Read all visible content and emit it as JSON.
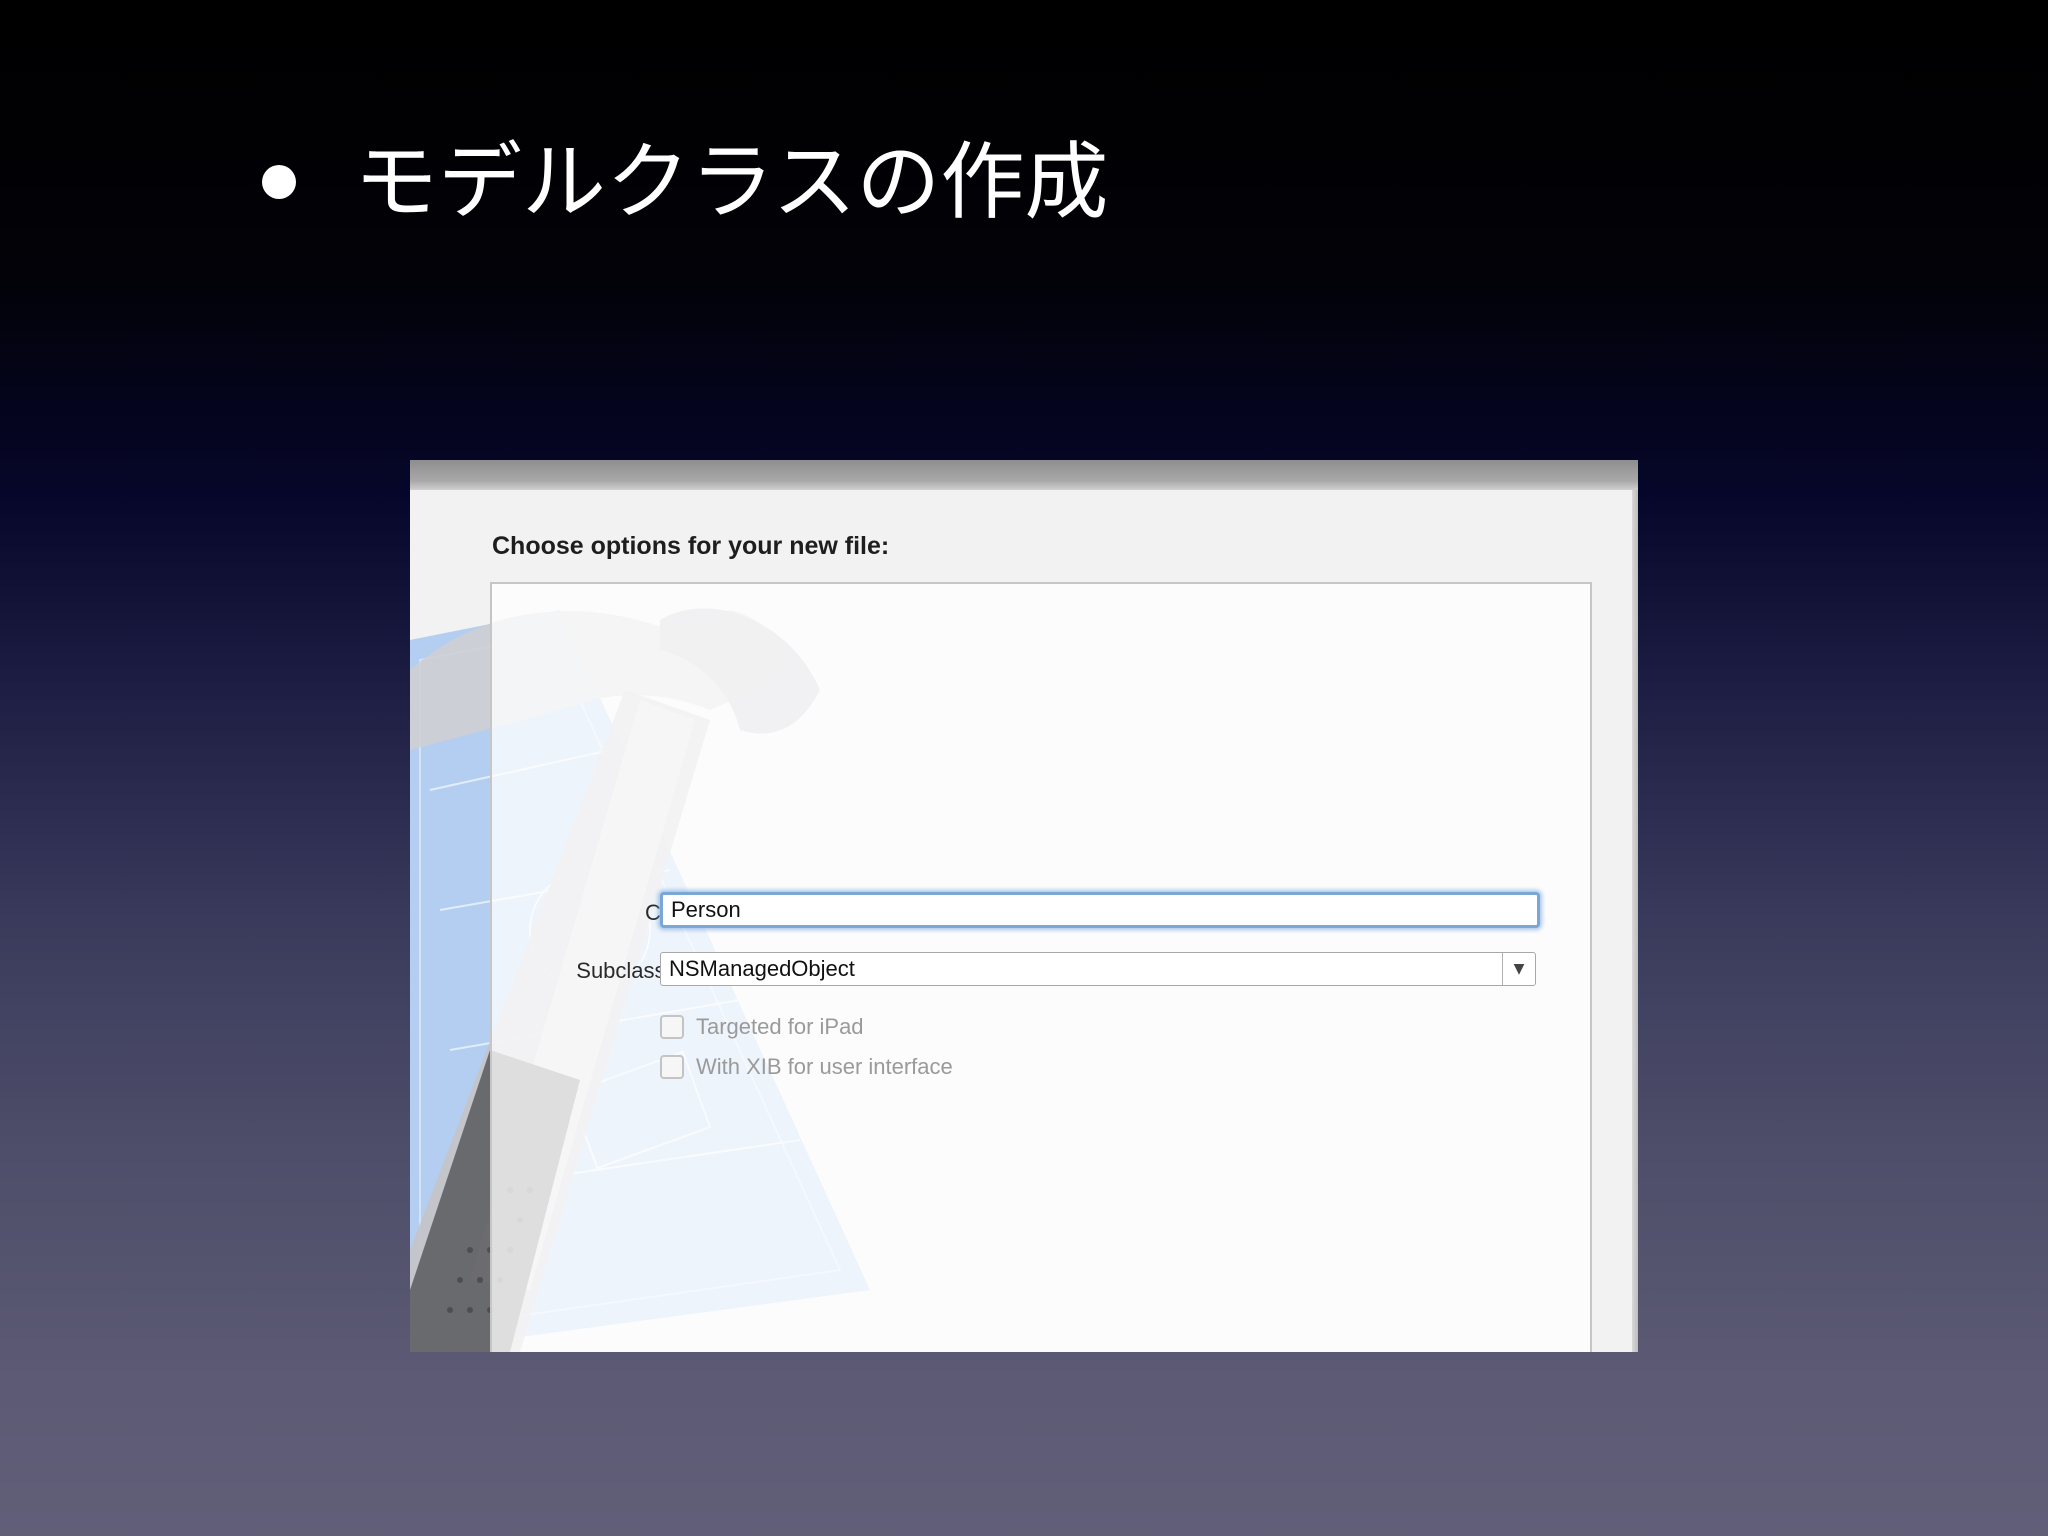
{
  "slide": {
    "bullet_title": "モデルクラスの作成"
  },
  "dialog": {
    "heading": "Choose options for your new file:",
    "class_label": "Class",
    "class_value": "Person",
    "subclass_label": "Subclass of",
    "subclass_value": "NSManagedObject",
    "dropdown_arrow": "▼",
    "checkboxes": [
      {
        "label": "Targeted for iPad",
        "checked": false,
        "enabled": false
      },
      {
        "label": "With XIB for user interface",
        "checked": false,
        "enabled": false
      }
    ]
  },
  "colors": {
    "focus_ring": "#7aa7d6",
    "blueprint": "#a8c8f0",
    "disabled_text": "#9a9a9a"
  },
  "icons": {
    "background_art": "xcode-hammer-blueprint-icon",
    "dropdown": "chevron-down-icon"
  }
}
